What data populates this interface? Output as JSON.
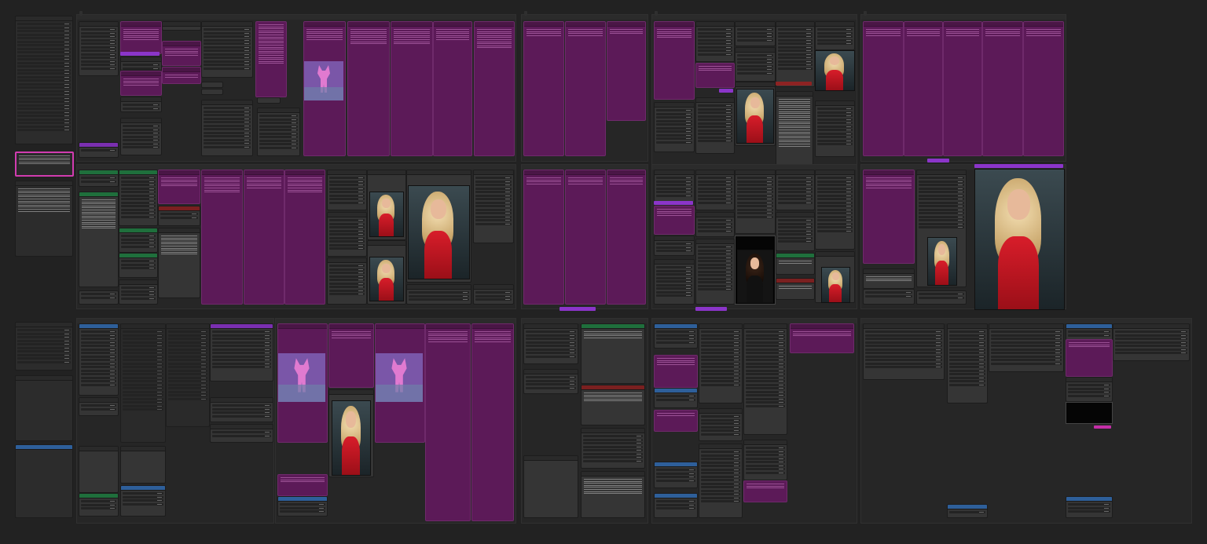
{
  "canvas": {
    "background": "#222222",
    "node_purple": "#5c1a58",
    "accent_violet": "#8b35c9",
    "accent_green": "#22804a",
    "accent_blue": "#3b78bd",
    "accent_red": "#8d2323",
    "accent_pink": "#d23cb0"
  },
  "groups": [
    {
      "id": "g1",
      "label": ""
    },
    {
      "id": "g2",
      "label": ""
    },
    {
      "id": "g3",
      "label": ""
    },
    {
      "id": "g4",
      "label": ""
    },
    {
      "id": "g5",
      "label": ""
    },
    {
      "id": "g6",
      "label": ""
    }
  ],
  "badges": {
    "group_main": "",
    "group_inspire": ""
  },
  "left_column": {
    "title": "",
    "lines": []
  },
  "images": [
    {
      "id": "portrait-blonde-red-dress",
      "icon": "photo-icon"
    },
    {
      "id": "portrait-dark-hair",
      "icon": "photo-icon"
    },
    {
      "id": "glitch-preview",
      "icon": "image-placeholder-icon"
    }
  ]
}
